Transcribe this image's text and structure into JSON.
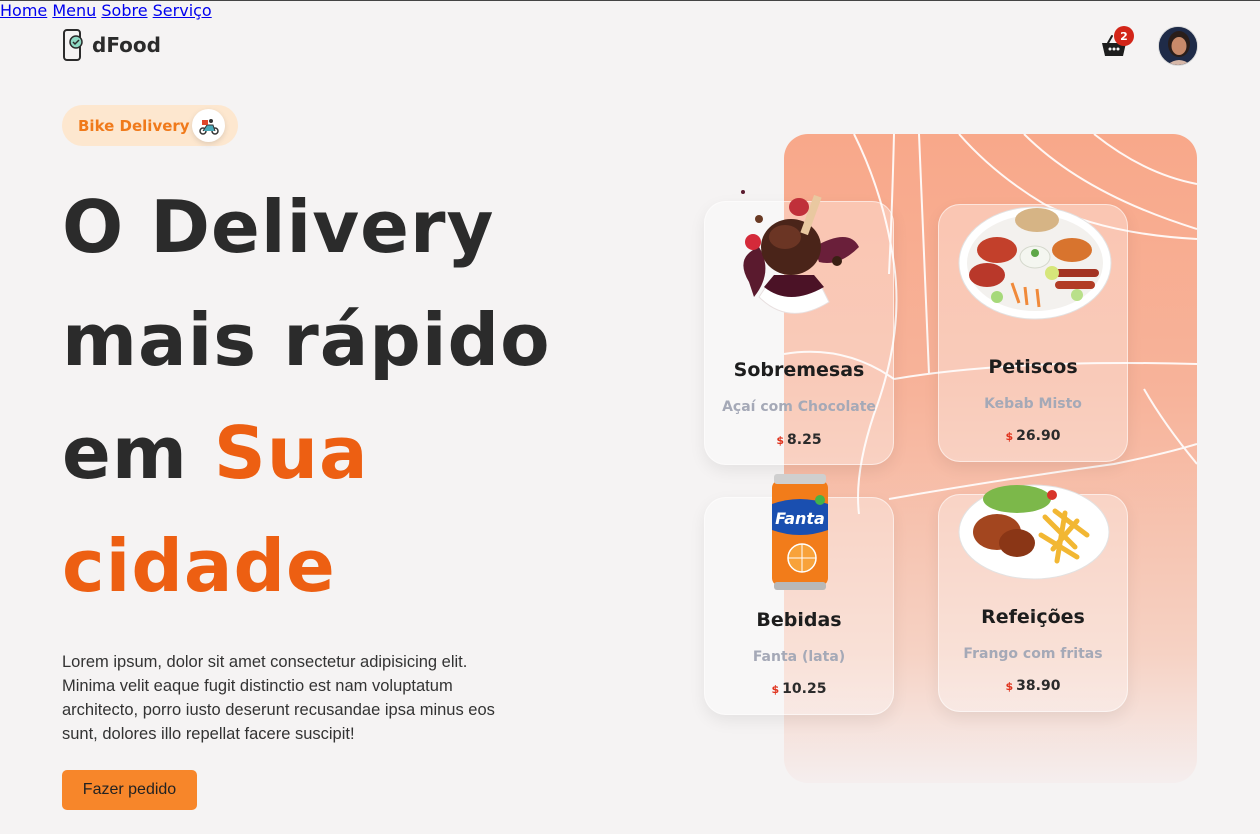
{
  "brand": {
    "name": "dFood"
  },
  "nav": {
    "items": [
      {
        "label": "Home"
      },
      {
        "label": "Menu"
      },
      {
        "label": "Sobre"
      },
      {
        "label": "Serviço"
      }
    ],
    "cart_count": "2"
  },
  "hero": {
    "pill_label": "Bike Delivery",
    "headline": {
      "line1": "O Delivery",
      "line2": "mais rápido",
      "line3_plain": "em ",
      "line3_highlight": "Sua",
      "line4_highlight": "cidade"
    },
    "description": "Lorem ipsum, dolor sit amet consectetur adipisicing elit. Minima velit eaque fugit distinctio est nam voluptatum architecto, porro iusto deserunt recusandae ipsa minus eos sunt, dolores illo repellat facere suscipit!",
    "cta_label": "Fazer pedido"
  },
  "cards": [
    {
      "title": "Sobremesas",
      "item": "Açaí com Chocolate",
      "currency": "$",
      "price": "8.25",
      "image": "chocolate-dessert"
    },
    {
      "title": "Petiscos",
      "item": "Kebab Misto",
      "currency": "$",
      "price": "26.90",
      "image": "kebab-platter"
    },
    {
      "title": "Bebidas",
      "item": "Fanta (lata)",
      "currency": "$",
      "price": "10.25",
      "image": "soda-can"
    },
    {
      "title": "Refeições",
      "item": "Frango com fritas",
      "currency": "$",
      "price": "38.90",
      "image": "chicken-fries-plate"
    }
  ],
  "colors": {
    "accent": "#ed5f12",
    "button": "#f7862a",
    "pill_bg": "#fde7cf",
    "badge": "#d32518",
    "panel": "#f8a88a"
  }
}
